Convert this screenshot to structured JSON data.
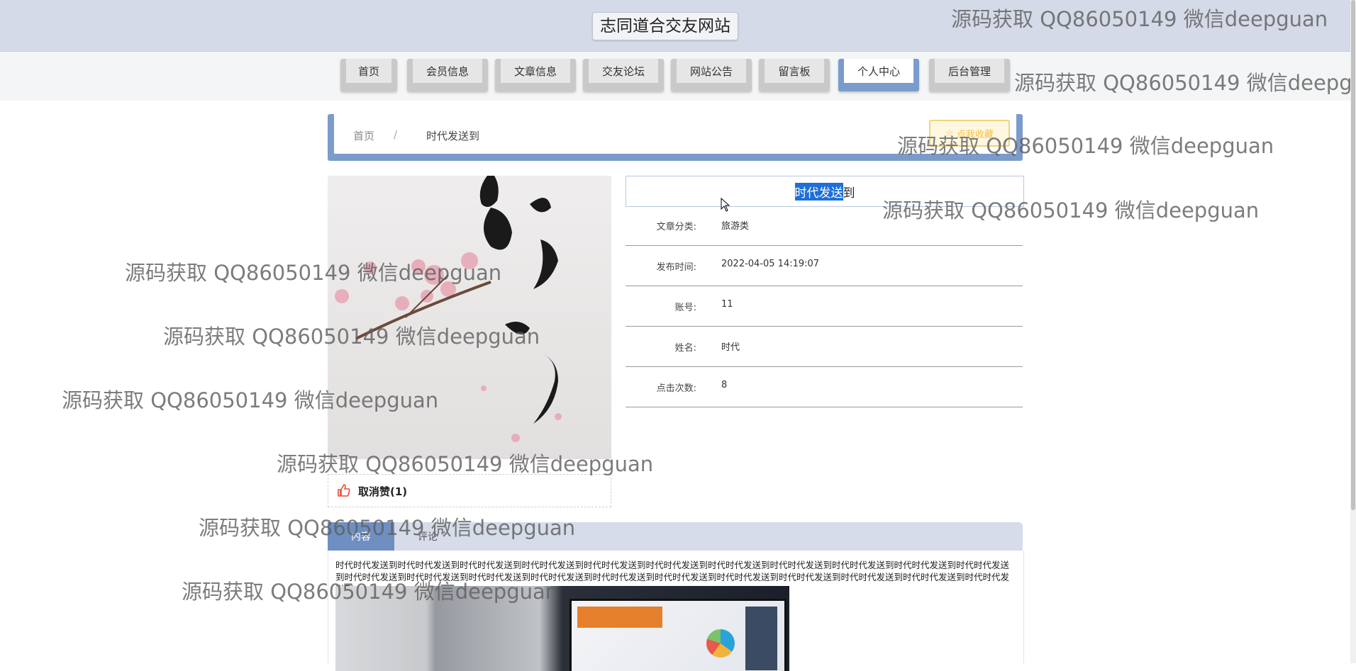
{
  "header": {
    "site_title": "志同道合交友网站"
  },
  "nav": [
    {
      "label": "首页",
      "active": false
    },
    {
      "label": "会员信息",
      "active": false
    },
    {
      "label": "文章信息",
      "active": false
    },
    {
      "label": "交友论坛",
      "active": false
    },
    {
      "label": "网站公告",
      "active": false
    },
    {
      "label": "留言板",
      "active": false
    },
    {
      "label": "个人中心",
      "active": true
    },
    {
      "label": "后台管理",
      "active": false
    }
  ],
  "breadcrumb": {
    "home": "首页",
    "sep": "/",
    "current": "时代发送到"
  },
  "favorite_button": "点我收藏",
  "article": {
    "title_selected": "时代发送",
    "title_rest": "到",
    "fields": [
      {
        "label": "文章分类:",
        "value": "旅游类"
      },
      {
        "label": "发布时间:",
        "value": "2022-04-05 14:19:07"
      },
      {
        "label": "账号:",
        "value": "11"
      },
      {
        "label": "姓名:",
        "value": "时代"
      },
      {
        "label": "点击次数:",
        "value": "8"
      }
    ]
  },
  "like": {
    "label": "取消赞(1)"
  },
  "tabs": [
    {
      "label": "内容",
      "active": true
    },
    {
      "label": "评论",
      "active": false
    }
  ],
  "content_text": "时代时代发送到时代时代发送到时代时代发送到时代时代发送到时代时代发送到时代时代发送到时代时代发送到时代时代发送到时代时代发送到时代时代发送到时代时代发送到时代时代发送到时代时代发送到时代时代发送到时代时代发送到时代时代发送到时代时代发送到时代时代发送到时代时代发送到时代时代发送到时代时代发送到时代时代发送到",
  "watermarks": [
    "源码获取 QQ86050149 微信deepguan",
    "源码获取 QQ86050149 微信deepg"
  ],
  "colors": {
    "header_bg": "#d5dae8",
    "accent": "#7b9bcb",
    "selection": "#1e6fd9",
    "like_icon": "#e64a3b"
  }
}
